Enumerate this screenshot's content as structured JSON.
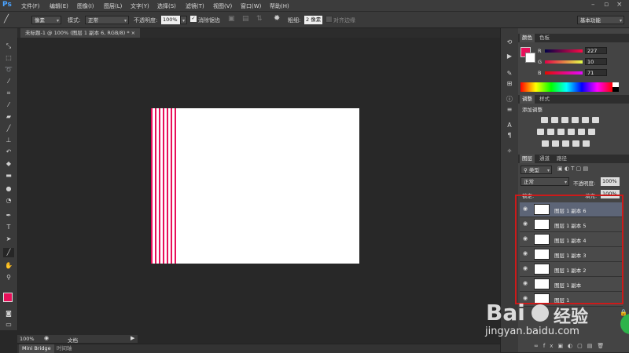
{
  "app": {
    "logo": "Ps"
  },
  "menu": [
    "文件(F)",
    "编辑(E)",
    "图像(I)",
    "图层(L)",
    "文字(Y)",
    "选择(S)",
    "滤镜(T)",
    "视图(V)",
    "窗口(W)",
    "帮助(H)"
  ],
  "options": {
    "unit": "像素",
    "mode_label": "模式:",
    "mode_value": "正常",
    "opacity_label": "不透明度:",
    "opacity_value": "100%",
    "antialias_label": "消除锯齿",
    "weight_label": "粗细:",
    "weight_value": "2 像素",
    "align_label": "对齐边缘",
    "workspace": "基本功能"
  },
  "document": {
    "tab_title": "未标题-1 @ 100% (图层 1 副本 6, RGB/8) *",
    "close": "×"
  },
  "status": {
    "zoom": "100%",
    "doc_label": "文档"
  },
  "bottom_tabs": [
    "Mini Bridge",
    "时间轴"
  ],
  "color_panel": {
    "tabs": [
      "颜色",
      "色板"
    ],
    "fg_color": "#e8105a",
    "bg_color": "#ffffff",
    "channels": [
      {
        "name": "R",
        "value": "227"
      },
      {
        "name": "G",
        "value": "10"
      },
      {
        "name": "B",
        "value": "71"
      }
    ]
  },
  "adjust_panel": {
    "tabs": [
      "调整",
      "样式"
    ],
    "title": "添加调整"
  },
  "layers_panel": {
    "tabs": [
      "图层",
      "通道",
      "路径"
    ],
    "filter_label": "类型",
    "blend_mode": "正常",
    "opacity_label": "不透明度:",
    "opacity_value": "100%",
    "lock_label": "锁定:",
    "fill_label": "填充:",
    "fill_value": "100%",
    "layers": [
      {
        "name": "图层 1 副本 6",
        "selected": true
      },
      {
        "name": "图层 1 副本 5",
        "selected": false
      },
      {
        "name": "图层 1 副本 4",
        "selected": false
      },
      {
        "name": "图层 1 副本 3",
        "selected": false
      },
      {
        "name": "图层 1 副本 2",
        "selected": false
      },
      {
        "name": "图层 1 副本",
        "selected": false
      },
      {
        "name": "图层 1",
        "selected": false
      }
    ]
  },
  "watermark": {
    "brand": "Bai",
    "site_name": "经验",
    "url": "jingyan.baidu.com"
  },
  "icons": [
    "move-icon",
    "marquee-icon",
    "lasso-icon",
    "magic-wand-icon",
    "crop-icon",
    "eyedropper-icon",
    "healing-brush-icon",
    "brush-icon",
    "clone-stamp-icon",
    "history-brush-icon",
    "eraser-icon",
    "gradient-icon",
    "blur-icon",
    "dodge-icon",
    "pen-icon",
    "type-icon",
    "path-selection-icon",
    "line-icon",
    "hand-icon",
    "zoom-icon",
    "eye-icon",
    "lock-icon"
  ],
  "canvas": {
    "stripe_color": "#e8105a",
    "background": "#ffffff",
    "stripe_count": 7
  }
}
